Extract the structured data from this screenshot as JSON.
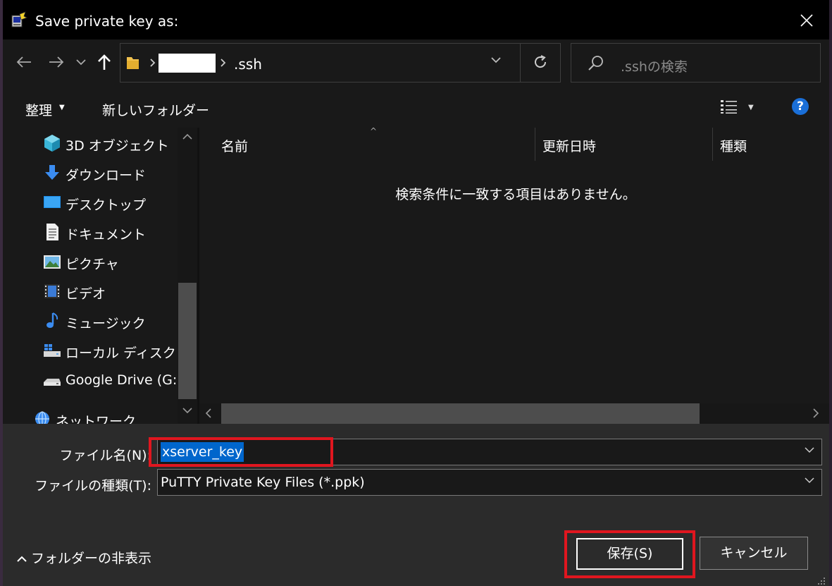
{
  "window": {
    "title": "Save private key as:"
  },
  "address": {
    "current_folder": ".ssh"
  },
  "search": {
    "placeholder": ".sshの検索"
  },
  "toolbar": {
    "organize_label": "整理",
    "new_folder_label": "新しいフォルダー"
  },
  "nav_pane": {
    "items": [
      {
        "label": "3D オブジェクト",
        "icon": "3d-objects-icon"
      },
      {
        "label": "ダウンロード",
        "icon": "download-icon"
      },
      {
        "label": "デスクトップ",
        "icon": "desktop-icon"
      },
      {
        "label": "ドキュメント",
        "icon": "document-icon"
      },
      {
        "label": "ピクチャ",
        "icon": "pictures-icon"
      },
      {
        "label": "ビデオ",
        "icon": "video-icon"
      },
      {
        "label": "ミュージック",
        "icon": "music-icon"
      },
      {
        "label": "ローカル ディスク (C:",
        "icon": "local-disk-icon"
      },
      {
        "label": "Google Drive (G:)",
        "icon": "drive-icon"
      },
      {
        "label": "ネットワーク",
        "icon": "network-icon"
      }
    ]
  },
  "file_list": {
    "columns": [
      "名前",
      "更新日時",
      "種類"
    ],
    "empty_message": "検索条件に一致する項目はありません。"
  },
  "form": {
    "filename_label": "ファイル名(N):",
    "filename_value": "xserver_key",
    "filetype_label": "ファイルの種類(T):",
    "filetype_value": "PuTTY Private Key Files (*.ppk)"
  },
  "footer": {
    "hide_folders_label": "フォルダーの非表示",
    "save_label": "保存(S)",
    "cancel_label": "キャンセル"
  },
  "colors": {
    "highlight": "#e0161f",
    "selection": "#0066cc",
    "help": "#1a6fd8"
  }
}
